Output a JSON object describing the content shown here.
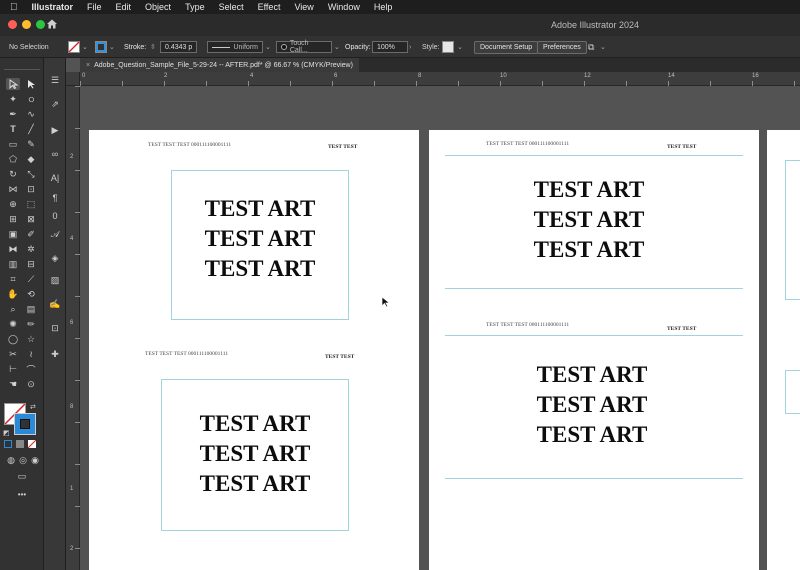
{
  "menubar": {
    "apple": "",
    "app": "Illustrator",
    "items": [
      "File",
      "Edit",
      "Object",
      "Type",
      "Select",
      "Effect",
      "View",
      "Window",
      "Help"
    ]
  },
  "titlebar": {
    "title": "Adobe Illustrator 2024"
  },
  "controlbar": {
    "selection": "No Selection",
    "stroke_label": "Stroke:",
    "stroke_value": "0.4343 p",
    "profile": "Uniform",
    "brush": "Touch Call...",
    "opacity_label": "Opacity:",
    "opacity_value": "100%",
    "style_label": "Style:",
    "document_setup": "Document Setup",
    "preferences": "Preferences"
  },
  "tab": {
    "title": "Adobe_Question_Sample_File_5-29-24 -- AFTER.pdf* @ 66.67 % (CMYK/Preview)",
    "close": "×"
  },
  "ruler": {
    "h_labels": [
      "0",
      "2",
      "4",
      "6",
      "8",
      "10",
      "12",
      "14",
      "16",
      "18"
    ],
    "v_labels": [
      "2",
      "4",
      "6",
      "8",
      "1",
      "2"
    ]
  },
  "pages": {
    "header_left": "TEST TEST TEST 000111100001111",
    "header_left_b": "TEST TEST TEST 000111100001111",
    "header_right": "TEST TEST",
    "art_line": "TEST ART"
  },
  "colors": {
    "menubar": "#1e1e1e",
    "toolbar": "#323232",
    "canvas": "#535353",
    "guide": "#9fd3e0",
    "accent": "#2b8ad8"
  }
}
